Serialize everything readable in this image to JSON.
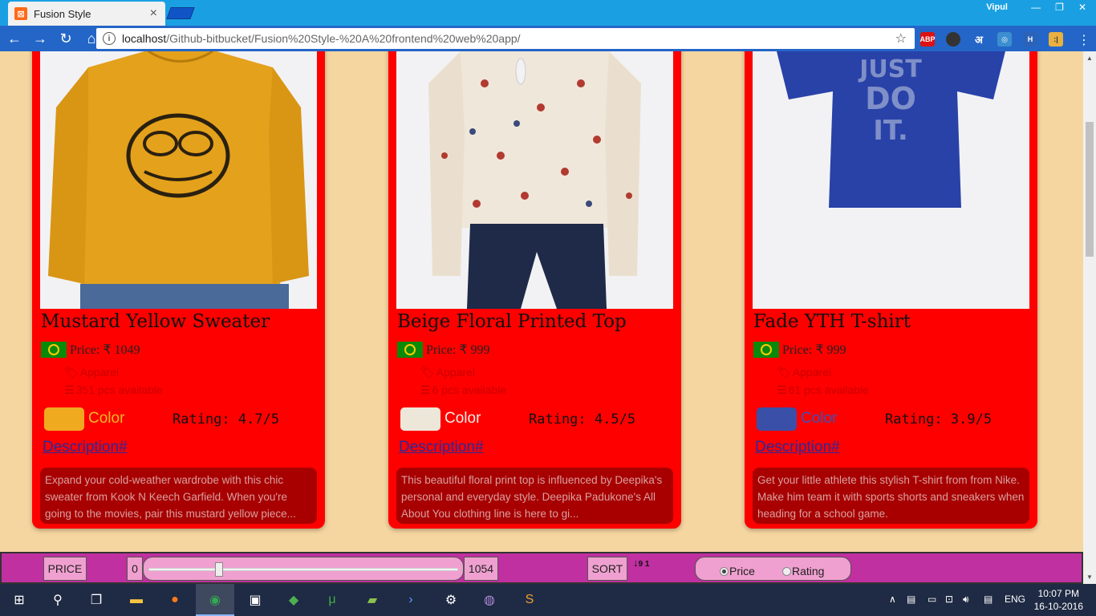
{
  "browser": {
    "tab_title": "Fusion Style",
    "tab_close": "×",
    "user": "Vipul",
    "url_host": "localhost",
    "url_path": "/Github-bitbucket/Fusion%20Style-%20A%20frontend%20web%20app/",
    "extensions": [
      "ABP",
      "अ"
    ]
  },
  "products": [
    {
      "name": "Mustard Yellow Sweater",
      "price": "Price: ₹ 1049",
      "category": "Apparel",
      "stock": "351 pcs available",
      "color_label": "Color",
      "color_hex": "#f0aa20",
      "color_text_hex": "#f5b824",
      "rating": "Rating: 4.7/5",
      "desc_link": "Description#",
      "description": "Expand your cold-weather wardrobe with this chic sweater from Kook N Keech Garfield. When you're going to the movies, pair this mustard yellow piece..."
    },
    {
      "name": "Beige Floral Printed Top",
      "price": "Price: ₹ 999",
      "category": "Apparel",
      "stock": "6 pcs available",
      "color_label": "Color",
      "color_hex": "#ede7da",
      "color_text_hex": "#f3efe6",
      "rating": "Rating: 4.5/5",
      "desc_link": "Description#",
      "description": "This beautiful floral print top is influenced by Deepika's personal and everyday style. Deepika Padukone's All About You clothing line is here to gi..."
    },
    {
      "name": "Fade YTH T-shirt",
      "price": "Price: ₹ 999",
      "category": "Apparel",
      "stock": "61 pcs available",
      "color_label": "Color",
      "color_hex": "#3a4fa8",
      "color_text_hex": "#3b52b4",
      "rating": "Rating: 3.9/5",
      "desc_link": "Description#",
      "description": "Get your little athlete this stylish T-shirt from from Nike. Make him team it with sports shorts and sneakers when heading for a school game."
    }
  ],
  "filter": {
    "price_label": "PRICE",
    "min_value": "0",
    "max_value": "1054",
    "slider_position": 0.22,
    "sort_label": "SORT",
    "sort_icon": "sort-numeric-desc-icon",
    "sort_icon_text": "9 1",
    "radio_price": "Price",
    "radio_rating": "Rating",
    "selected": "price"
  },
  "taskbar": {
    "language": "ENG",
    "time": "10:07 PM",
    "date": "16-10-2016"
  }
}
